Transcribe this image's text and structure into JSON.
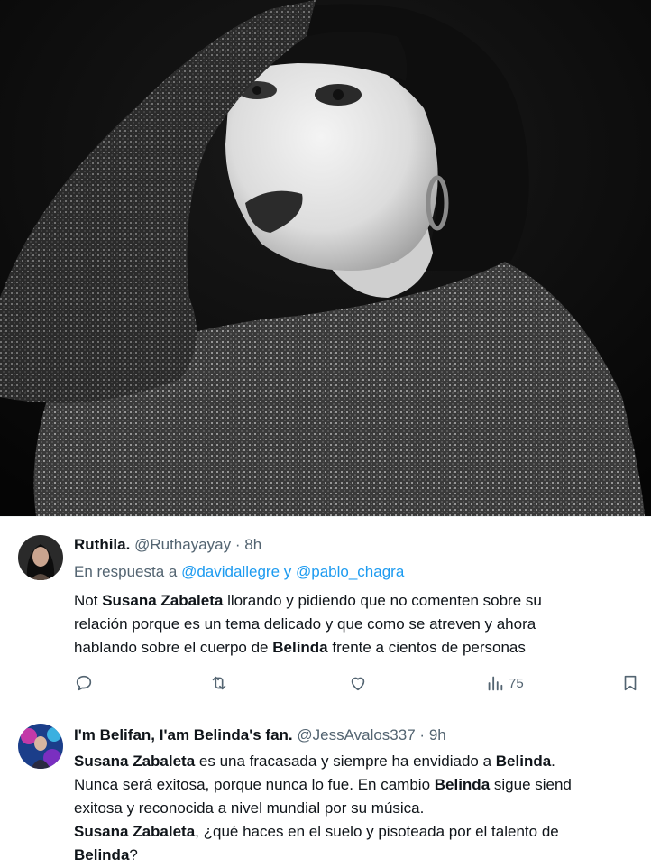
{
  "tweets": [
    {
      "name": "Ruthila.",
      "handle": "@Ruthayayay",
      "separator": "·",
      "time": "8h",
      "reply_prefix": "En respuesta a",
      "reply_mention_1": "@davidallegre",
      "reply_joiner": "y",
      "reply_mention_2": "@pablo_chagra",
      "lines": [
        [
          "Not ",
          "Susana Zabaleta",
          " llorando y pidiendo que no comenten sobre su"
        ],
        [
          "relación porque es un tema delicado y que como se atreven y ahora"
        ],
        [
          "hablando sobre el cuerpo de ",
          "Belinda",
          " frente a cientos de personas"
        ]
      ],
      "views": "75",
      "icons": [
        "reply-icon",
        "retweet-icon",
        "like-icon",
        "views-icon",
        "bookmark-icon"
      ]
    },
    {
      "name": "I'm Belifan, I'am Belinda's fan.",
      "handle": "@JessAvalos337",
      "separator": "·",
      "time": "9h",
      "lines": [
        [
          "",
          "Susana Zabaleta",
          " es una fracasada y siempre ha envidiado a ",
          "Belinda",
          "."
        ],
        [
          "Nunca será exitosa, porque nunca lo fue. En cambio ",
          "Belinda",
          " sigue siend"
        ],
        [
          "exitosa y reconocida a nivel mundial por su música."
        ],
        [
          "",
          "Susana Zabaleta",
          ", ¿qué haces en el suelo y pisoteada por el talento de"
        ],
        [
          "",
          "Belinda",
          "?"
        ]
      ]
    }
  ],
  "colors": {
    "link": "#1d9bf0",
    "muted": "#536471",
    "text": "#0f1419"
  }
}
